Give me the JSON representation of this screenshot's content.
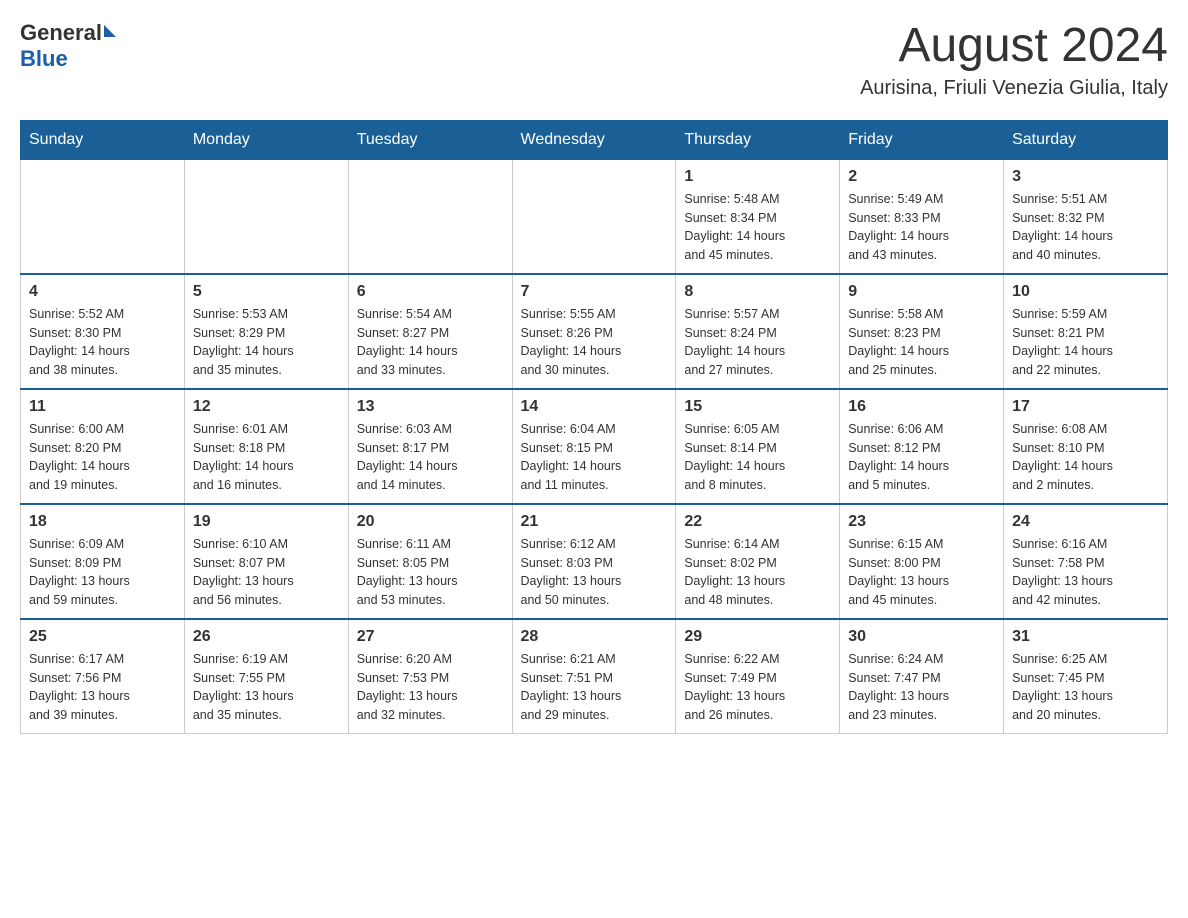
{
  "header": {
    "logo": {
      "general": "General",
      "blue": "Blue"
    },
    "month": "August 2024",
    "location": "Aurisina, Friuli Venezia Giulia, Italy"
  },
  "weekdays": [
    "Sunday",
    "Monday",
    "Tuesday",
    "Wednesday",
    "Thursday",
    "Friday",
    "Saturday"
  ],
  "weeks": [
    [
      {
        "day": "",
        "info": ""
      },
      {
        "day": "",
        "info": ""
      },
      {
        "day": "",
        "info": ""
      },
      {
        "day": "",
        "info": ""
      },
      {
        "day": "1",
        "info": "Sunrise: 5:48 AM\nSunset: 8:34 PM\nDaylight: 14 hours\nand 45 minutes."
      },
      {
        "day": "2",
        "info": "Sunrise: 5:49 AM\nSunset: 8:33 PM\nDaylight: 14 hours\nand 43 minutes."
      },
      {
        "day": "3",
        "info": "Sunrise: 5:51 AM\nSunset: 8:32 PM\nDaylight: 14 hours\nand 40 minutes."
      }
    ],
    [
      {
        "day": "4",
        "info": "Sunrise: 5:52 AM\nSunset: 8:30 PM\nDaylight: 14 hours\nand 38 minutes."
      },
      {
        "day": "5",
        "info": "Sunrise: 5:53 AM\nSunset: 8:29 PM\nDaylight: 14 hours\nand 35 minutes."
      },
      {
        "day": "6",
        "info": "Sunrise: 5:54 AM\nSunset: 8:27 PM\nDaylight: 14 hours\nand 33 minutes."
      },
      {
        "day": "7",
        "info": "Sunrise: 5:55 AM\nSunset: 8:26 PM\nDaylight: 14 hours\nand 30 minutes."
      },
      {
        "day": "8",
        "info": "Sunrise: 5:57 AM\nSunset: 8:24 PM\nDaylight: 14 hours\nand 27 minutes."
      },
      {
        "day": "9",
        "info": "Sunrise: 5:58 AM\nSunset: 8:23 PM\nDaylight: 14 hours\nand 25 minutes."
      },
      {
        "day": "10",
        "info": "Sunrise: 5:59 AM\nSunset: 8:21 PM\nDaylight: 14 hours\nand 22 minutes."
      }
    ],
    [
      {
        "day": "11",
        "info": "Sunrise: 6:00 AM\nSunset: 8:20 PM\nDaylight: 14 hours\nand 19 minutes."
      },
      {
        "day": "12",
        "info": "Sunrise: 6:01 AM\nSunset: 8:18 PM\nDaylight: 14 hours\nand 16 minutes."
      },
      {
        "day": "13",
        "info": "Sunrise: 6:03 AM\nSunset: 8:17 PM\nDaylight: 14 hours\nand 14 minutes."
      },
      {
        "day": "14",
        "info": "Sunrise: 6:04 AM\nSunset: 8:15 PM\nDaylight: 14 hours\nand 11 minutes."
      },
      {
        "day": "15",
        "info": "Sunrise: 6:05 AM\nSunset: 8:14 PM\nDaylight: 14 hours\nand 8 minutes."
      },
      {
        "day": "16",
        "info": "Sunrise: 6:06 AM\nSunset: 8:12 PM\nDaylight: 14 hours\nand 5 minutes."
      },
      {
        "day": "17",
        "info": "Sunrise: 6:08 AM\nSunset: 8:10 PM\nDaylight: 14 hours\nand 2 minutes."
      }
    ],
    [
      {
        "day": "18",
        "info": "Sunrise: 6:09 AM\nSunset: 8:09 PM\nDaylight: 13 hours\nand 59 minutes."
      },
      {
        "day": "19",
        "info": "Sunrise: 6:10 AM\nSunset: 8:07 PM\nDaylight: 13 hours\nand 56 minutes."
      },
      {
        "day": "20",
        "info": "Sunrise: 6:11 AM\nSunset: 8:05 PM\nDaylight: 13 hours\nand 53 minutes."
      },
      {
        "day": "21",
        "info": "Sunrise: 6:12 AM\nSunset: 8:03 PM\nDaylight: 13 hours\nand 50 minutes."
      },
      {
        "day": "22",
        "info": "Sunrise: 6:14 AM\nSunset: 8:02 PM\nDaylight: 13 hours\nand 48 minutes."
      },
      {
        "day": "23",
        "info": "Sunrise: 6:15 AM\nSunset: 8:00 PM\nDaylight: 13 hours\nand 45 minutes."
      },
      {
        "day": "24",
        "info": "Sunrise: 6:16 AM\nSunset: 7:58 PM\nDaylight: 13 hours\nand 42 minutes."
      }
    ],
    [
      {
        "day": "25",
        "info": "Sunrise: 6:17 AM\nSunset: 7:56 PM\nDaylight: 13 hours\nand 39 minutes."
      },
      {
        "day": "26",
        "info": "Sunrise: 6:19 AM\nSunset: 7:55 PM\nDaylight: 13 hours\nand 35 minutes."
      },
      {
        "day": "27",
        "info": "Sunrise: 6:20 AM\nSunset: 7:53 PM\nDaylight: 13 hours\nand 32 minutes."
      },
      {
        "day": "28",
        "info": "Sunrise: 6:21 AM\nSunset: 7:51 PM\nDaylight: 13 hours\nand 29 minutes."
      },
      {
        "day": "29",
        "info": "Sunrise: 6:22 AM\nSunset: 7:49 PM\nDaylight: 13 hours\nand 26 minutes."
      },
      {
        "day": "30",
        "info": "Sunrise: 6:24 AM\nSunset: 7:47 PM\nDaylight: 13 hours\nand 23 minutes."
      },
      {
        "day": "31",
        "info": "Sunrise: 6:25 AM\nSunset: 7:45 PM\nDaylight: 13 hours\nand 20 minutes."
      }
    ]
  ]
}
